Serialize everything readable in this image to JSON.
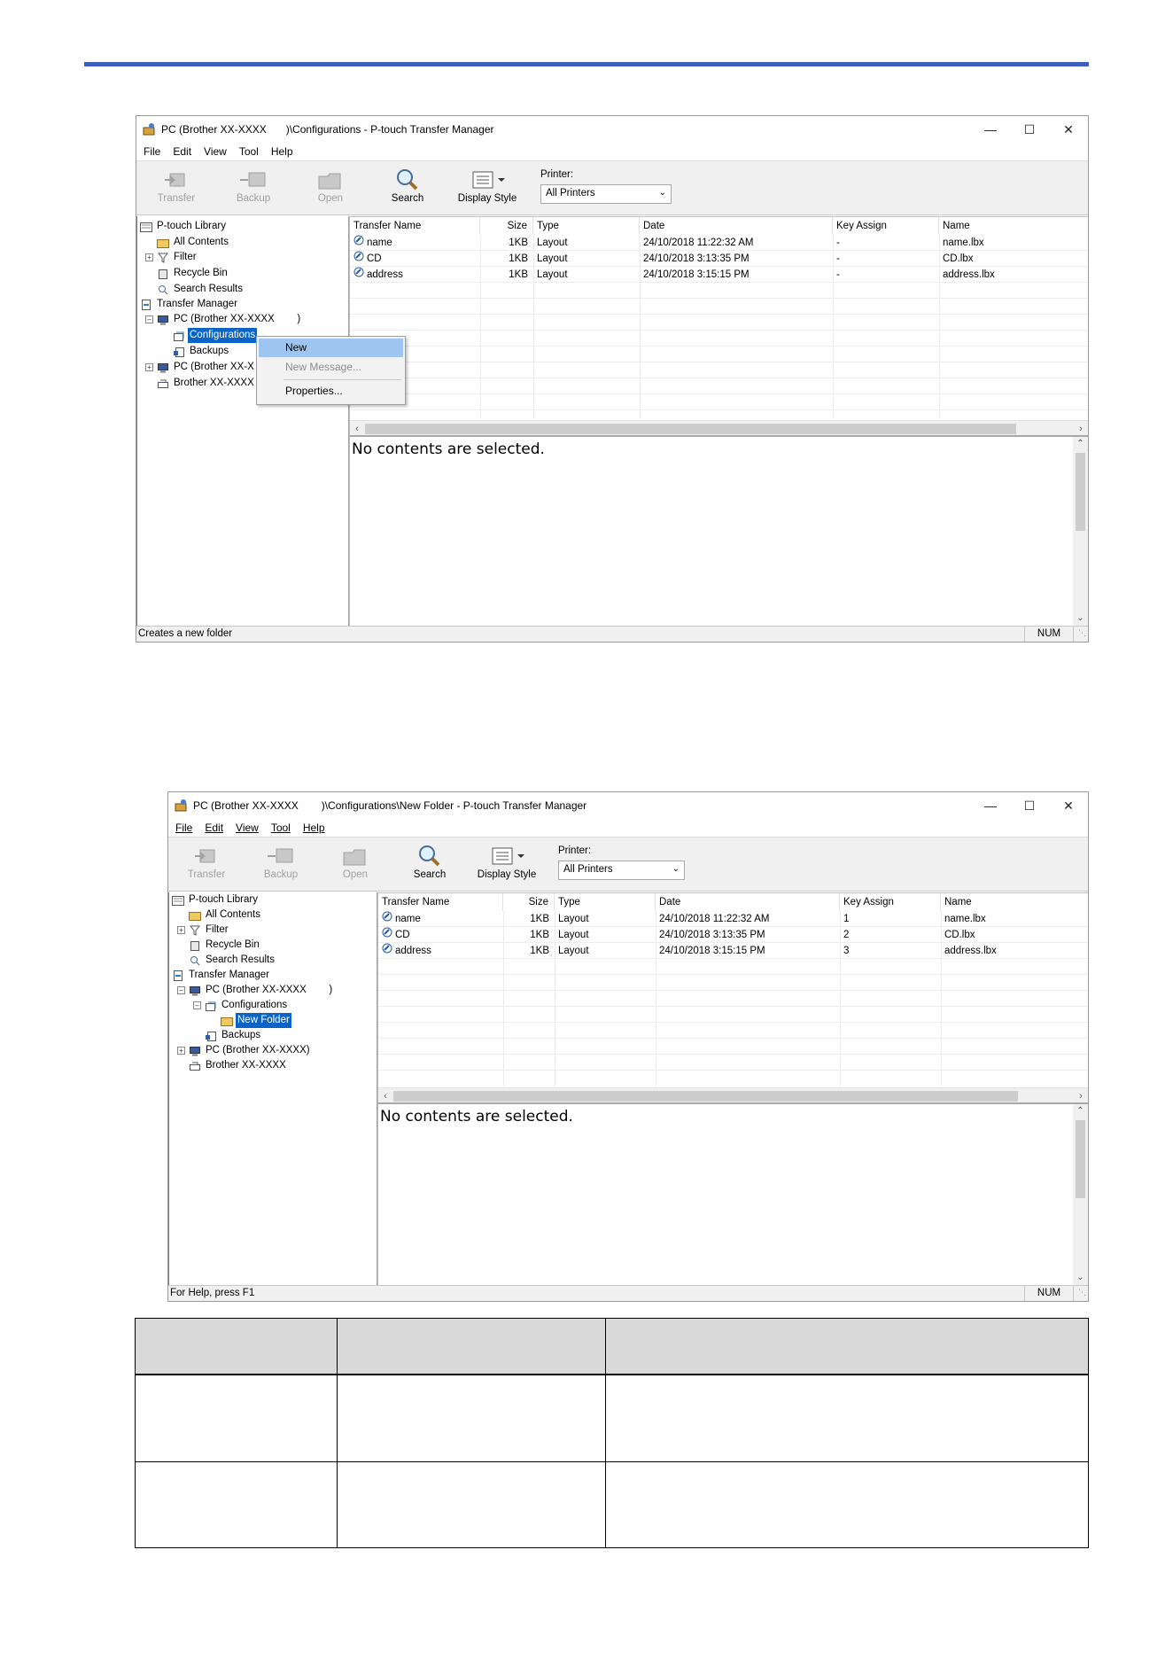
{
  "window1": {
    "title_prefix": "PC (Brother XX-XXXX",
    "title_suffix": ")\\Configurations - P-touch Transfer Manager",
    "menu": [
      "File",
      "Edit",
      "View",
      "Tool",
      "Help"
    ],
    "toolbar": {
      "transfer": "Transfer",
      "backup": "Backup",
      "open": "Open",
      "search": "Search",
      "display_style": "Display Style",
      "printer_label": "Printer:",
      "printer_value": "All Printers"
    },
    "tree": {
      "library": "P-touch Library",
      "all_contents": "All Contents",
      "filter": "Filter",
      "recycle_bin": "Recycle Bin",
      "search_results": "Search Results",
      "transfer_manager": "Transfer Manager",
      "pc1": "PC (Brother XX-XXXX        )",
      "configurations": "Configurations",
      "backups": "Backups",
      "pc2": "PC (Brother XX-X",
      "brother": "Brother XX-XXXX"
    },
    "columns": [
      "Transfer Name",
      "Size",
      "Type",
      "Date",
      "Key Assign",
      "Name"
    ],
    "rows": [
      {
        "name": "name",
        "size": "1KB",
        "type": "Layout",
        "date": "24/10/2018 11:22:32 AM",
        "key": "-",
        "file": "name.lbx"
      },
      {
        "name": "CD",
        "size": "1KB",
        "type": "Layout",
        "date": "24/10/2018 3:13:35 PM",
        "key": "-",
        "file": "CD.lbx"
      },
      {
        "name": "address",
        "size": "1KB",
        "type": "Layout",
        "date": "24/10/2018 3:15:15 PM",
        "key": "-",
        "file": "address.lbx"
      }
    ],
    "context_menu": {
      "new": "New",
      "new_message": "New Message...",
      "properties": "Properties..."
    },
    "preview_message": "No contents are selected.",
    "status": "Creates a new folder",
    "status_num": "NUM"
  },
  "window2": {
    "title_prefix": "PC (Brother XX-XXXX",
    "title_suffix": ")\\Configurations\\New Folder - P-touch Transfer Manager",
    "menu": [
      "File",
      "Edit",
      "View",
      "Tool",
      "Help"
    ],
    "toolbar": {
      "transfer": "Transfer",
      "backup": "Backup",
      "open": "Open",
      "search": "Search",
      "display_style": "Display Style",
      "printer_label": "Printer:",
      "printer_value": "All Printers"
    },
    "tree": {
      "library": "P-touch Library",
      "all_contents": "All Contents",
      "filter": "Filter",
      "recycle_bin": "Recycle Bin",
      "search_results": "Search Results",
      "transfer_manager": "Transfer Manager",
      "pc1": "PC (Brother XX-XXXX        )",
      "configurations": "Configurations",
      "new_folder": "New Folder",
      "backups": "Backups",
      "pc2": "PC (Brother XX-XXXX)",
      "brother": "Brother XX-XXXX"
    },
    "columns": [
      "Transfer Name",
      "Size",
      "Type",
      "Date",
      "Key Assign",
      "Name"
    ],
    "rows": [
      {
        "name": "name",
        "size": "1KB",
        "type": "Layout",
        "date": "24/10/2018 11:22:32 AM",
        "key": "1",
        "file": "name.lbx"
      },
      {
        "name": "CD",
        "size": "1KB",
        "type": "Layout",
        "date": "24/10/2018 3:13:35 PM",
        "key": "2",
        "file": "CD.lbx"
      },
      {
        "name": "address",
        "size": "1KB",
        "type": "Layout",
        "date": "24/10/2018 3:15:15 PM",
        "key": "3",
        "file": "address.lbx"
      }
    ],
    "preview_message": "No contents are selected.",
    "status": "For Help, press F1",
    "status_num": "NUM"
  }
}
